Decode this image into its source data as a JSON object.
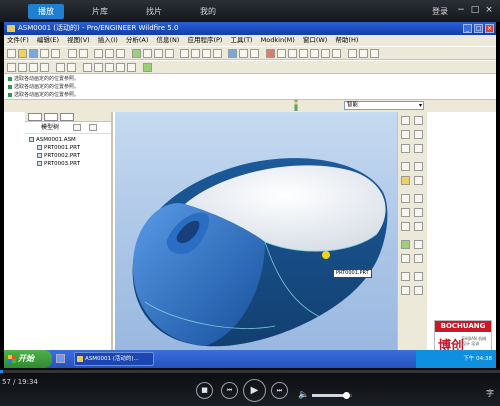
{
  "player": {
    "tabs": [
      {
        "label": "播放",
        "active": true
      },
      {
        "label": "片库",
        "active": false
      },
      {
        "label": "找片",
        "active": false
      },
      {
        "label": "我的",
        "active": false
      }
    ],
    "login_label": "登录",
    "window_buttons": {
      "minimize": "−",
      "maximize": "□",
      "close": "×"
    },
    "accent_color": "#1f7fd0",
    "time": {
      "current": "57",
      "total": "19:34",
      "display": "57 / 19:34"
    },
    "progress_fraction": 0.005,
    "volume_fraction": 0.85,
    "corner_label": "字"
  },
  "proe": {
    "title": "ASM0001 (活动的) - Pro/ENGINEER Wildfire 5.0",
    "menus": [
      "文件(F)",
      "编辑(E)",
      "视图(V)",
      "插入(I)",
      "分析(A)",
      "信息(N)",
      "应用程序(P)",
      "工具(T)",
      "Modkin(M)",
      "窗口(W)",
      "帮助(H)"
    ],
    "messages": [
      "选取各动画定的的位置参照。",
      "选取各动画定的的位置参照。",
      "选取各动画定的的位置参照。"
    ],
    "filter": "智能",
    "model_tree": {
      "header": "模型树",
      "items": [
        "ASM0001.ASM",
        "PRT0001.PRT",
        "PRT0002.PRT",
        "PRT0003.PRT"
      ]
    },
    "part_label": "PRT0001.PRT"
  },
  "logo": {
    "brand": "BOCHUANG",
    "name": "博创",
    "sub": "SHIJIAN 机械 设计 培训"
  },
  "taskbar": {
    "start_label": "开始",
    "task_item": "ASM0001 (活动的)...",
    "tray_time": "下午 04:38"
  }
}
